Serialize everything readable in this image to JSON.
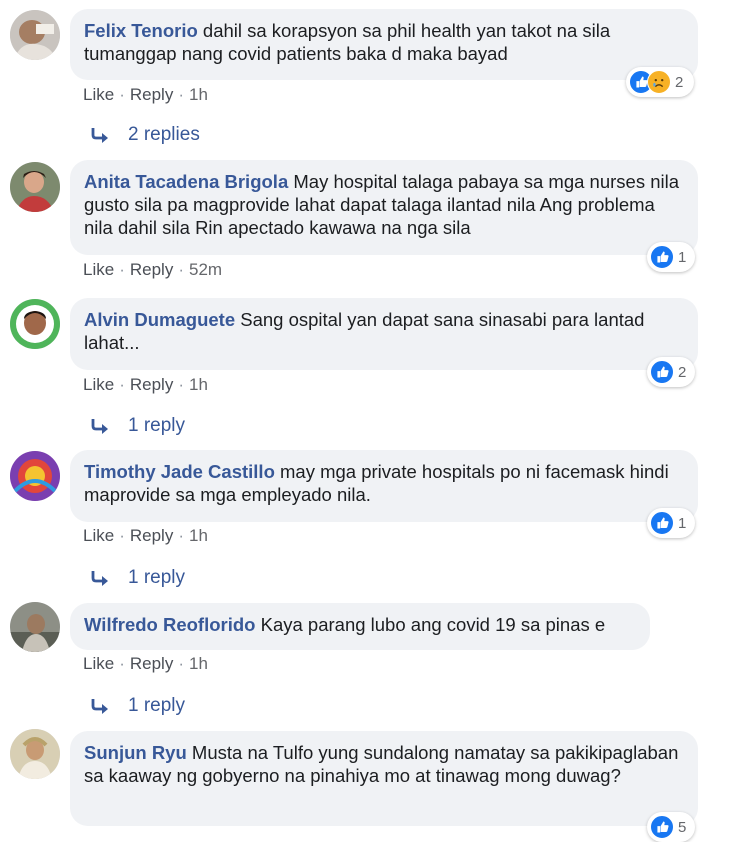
{
  "comments": [
    {
      "author": "Felix Tenorio",
      "text": "dahil sa korapsyon sa phil health yan takot na sila tumanggap nang covid patients baka d maka bayad",
      "like_label": "Like",
      "reply_label": "Reply",
      "time": "1h",
      "reaction_count": "2",
      "reactions": [
        "like-icon",
        "sad-icon"
      ],
      "replies_label": "2 replies"
    },
    {
      "author": "Anita Tacadena Brigola",
      "text": "May hospital talaga pabaya sa mga nurses nila gusto sila pa magprovide lahat dapat talaga ilantad nila Ang problema nila dahil sila Rin apectado kawawa na nga sila",
      "like_label": "Like",
      "reply_label": "Reply",
      "time": "52m",
      "reaction_count": "1",
      "reactions": [
        "like-icon"
      ]
    },
    {
      "author": "Alvin Dumaguete",
      "text": "Sang ospital yan dapat sana sinasabi para lantad lahat...",
      "like_label": "Like",
      "reply_label": "Reply",
      "time": "1h",
      "reaction_count": "2",
      "reactions": [
        "like-icon"
      ],
      "replies_label": "1 reply"
    },
    {
      "author": "Timothy Jade Castillo",
      "text": "may mga private hospitals po ni facemask hindi maprovide sa mga empleyado nila.",
      "like_label": "Like",
      "reply_label": "Reply",
      "time": "1h",
      "reaction_count": "1",
      "reactions": [
        "like-icon"
      ],
      "replies_label": "1 reply"
    },
    {
      "author": "Wilfredo Reoflorido",
      "text": "Kaya parang lubo ang covid 19 sa pinas e",
      "like_label": "Like",
      "reply_label": "Reply",
      "time": "1h",
      "replies_label": "1 reply"
    },
    {
      "author": "Sunjun Ryu",
      "text": "Musta na Tulfo yung sundalong namatay sa pakikipaglaban sa kaaway ng gobyerno na pinahiya mo at tinawag mong duwag?",
      "reaction_count": "5",
      "reactions": [
        "like-icon"
      ]
    }
  ],
  "separator": "·",
  "colors": {
    "author": "#385898",
    "bubble": "#f0f2f5",
    "like": "#1877f2",
    "sad": "#f7b125",
    "meta": "#65676b"
  }
}
